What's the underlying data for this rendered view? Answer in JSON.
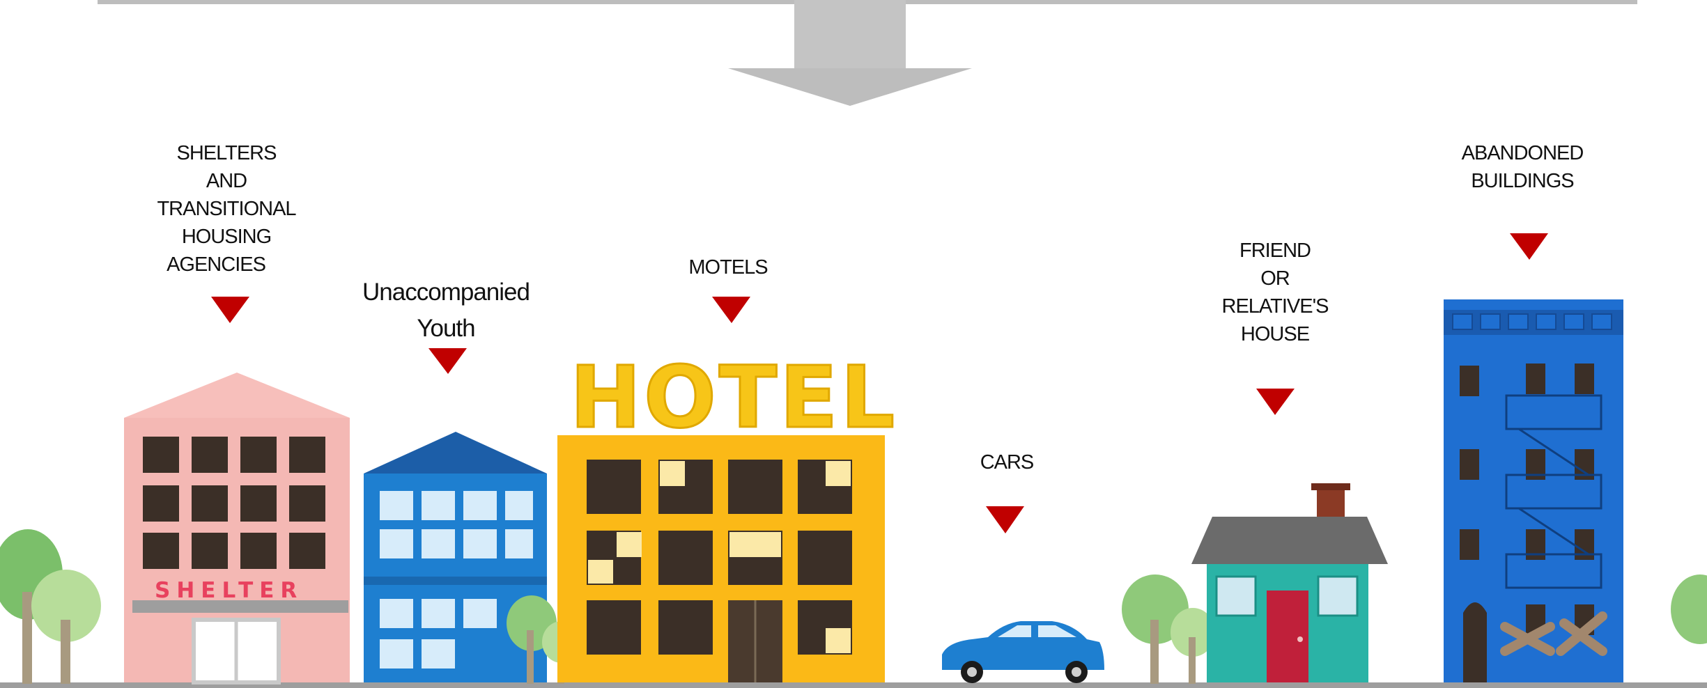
{
  "labels": {
    "shelters": [
      "SHELTERS",
      "AND",
      "TRANSITIONAL",
      "HOUSING",
      "AGENCIES"
    ],
    "youth": [
      "Unaccompanied",
      "Youth"
    ],
    "motels": [
      "MOTELS"
    ],
    "cars": [
      "CARS"
    ],
    "friend": [
      "FRIEND",
      "OR",
      "RELATIVE'S",
      "HOUSE"
    ],
    "abandoned": [
      "ABANDONED",
      "BUILDINGS"
    ]
  },
  "signs": {
    "hotel": "HOTEL",
    "shelter": "SHELTER"
  },
  "colors": {
    "arrow": "#bdbdbd",
    "marker": "#c00000",
    "shelter_building": "#f4b8b4",
    "youth_building": "#1e7fd0",
    "hotel_building": "#fbb917",
    "car": "#1e7fd0",
    "house": "#2ab3a6",
    "abandoned_building": "#1f6fd1"
  }
}
